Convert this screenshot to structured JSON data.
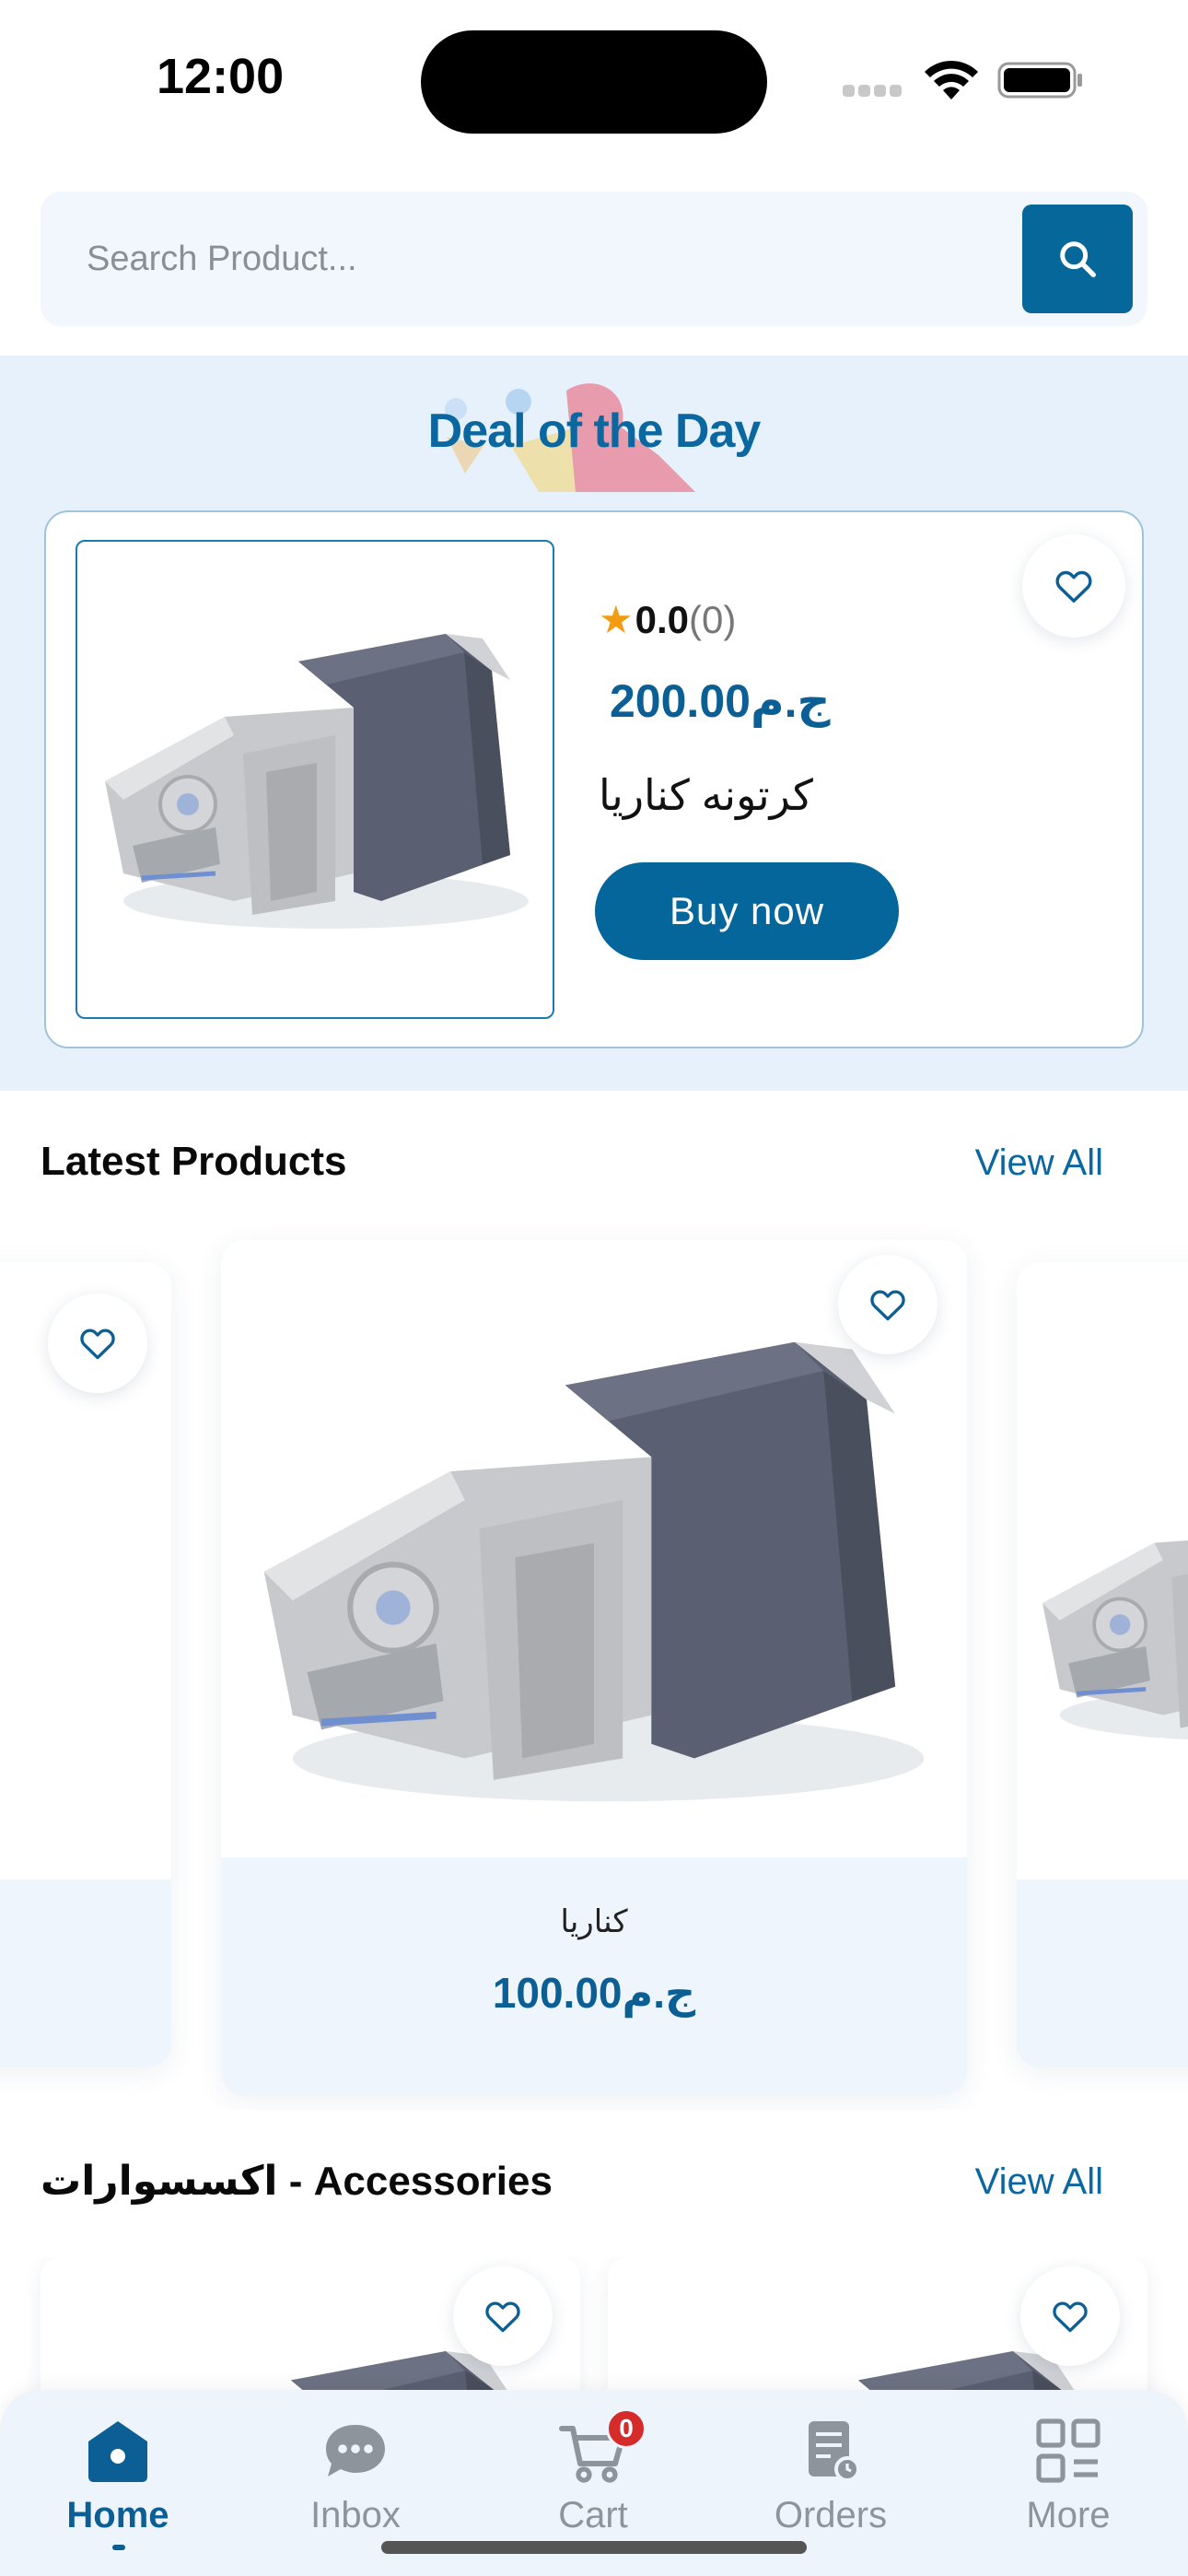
{
  "status_bar": {
    "time": "12:00"
  },
  "search": {
    "placeholder": "Search Product..."
  },
  "deal": {
    "title": "Deal of the Day",
    "rating": "0.0",
    "rating_count": "(0)",
    "price": "200.00ج.م",
    "product_name": "كرتونه كناريا",
    "buy_label": "Buy now"
  },
  "latest": {
    "title": "Latest Products",
    "view_all": "View All",
    "products": [
      {
        "name": "كناريا",
        "price": "100.00ج.م"
      }
    ]
  },
  "accessories": {
    "title": "اكسسوارات - Accessories",
    "view_all": "View All"
  },
  "nav": {
    "items": [
      {
        "label": "Home",
        "icon": "home-icon"
      },
      {
        "label": "Inbox",
        "icon": "chat-icon"
      },
      {
        "label": "Cart",
        "icon": "cart-icon",
        "badge": "0"
      },
      {
        "label": "Orders",
        "icon": "orders-icon"
      },
      {
        "label": "More",
        "icon": "grid-icon"
      }
    ]
  },
  "colors": {
    "primary": "#06679a",
    "deal_bg": "#e7f1fc",
    "card_info_bg": "#eef5fc",
    "badge": "#d62b2b"
  }
}
